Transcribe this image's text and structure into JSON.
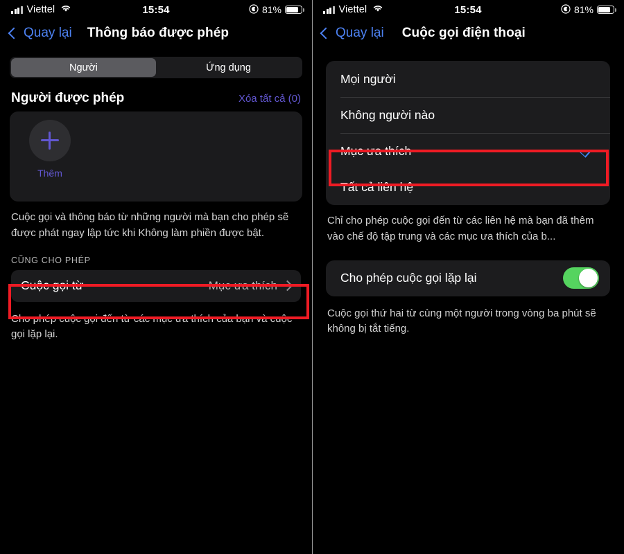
{
  "status_bar": {
    "carrier": "Viettel",
    "time": "15:54",
    "battery_percent": "81%",
    "signal_icon": "cellular-bars-icon",
    "wifi_icon": "wifi-icon",
    "focus_icon": "focus-moon-icon",
    "battery_icon": "battery-icon"
  },
  "left_screen": {
    "nav": {
      "back_label": "Quay lại",
      "title": "Thông báo được phép"
    },
    "segmented": {
      "options": [
        "Người",
        "Ứng dụng"
      ],
      "selected_index": 0
    },
    "section": {
      "title": "Người được phép",
      "action_label": "Xóa tất cả (0)"
    },
    "people_card": {
      "add_label": "Thêm",
      "add_icon": "plus-icon"
    },
    "footnote_1": "Cuộc gọi và thông báo từ những người mà bạn cho phép sẽ được phát ngay lập tức khi Không làm phiền được bật.",
    "group_header": "CŨNG CHO PHÉP",
    "calls_row": {
      "label": "Cuộc gọi từ",
      "value": "Mục ưa thích",
      "chevron_icon": "chevron-right-icon"
    },
    "footnote_2": "Cho phép cuộc gọi đến từ các mục ưa thích của bạn và cuộc gọi lặp lại."
  },
  "right_screen": {
    "nav": {
      "back_label": "Quay lại",
      "title": "Cuộc gọi điện thoại"
    },
    "menu": {
      "items": [
        {
          "label": "Mọi người",
          "checked": false
        },
        {
          "label": "Không người nào",
          "checked": false
        },
        {
          "label": "Mục ưa thích",
          "checked": true
        },
        {
          "label": "Tất cả liên hệ",
          "checked": false
        }
      ],
      "check_icon": "checkmark-icon"
    },
    "footnote_1": "Chỉ cho phép cuộc gọi đến từ các liên hệ mà bạn đã thêm vào chế độ tập trung và các mục ưa thích của b...",
    "repeat_row": {
      "label": "Cho phép cuộc gọi lặp lại",
      "toggle_on": true
    },
    "footnote_2": "Cuộc gọi thứ hai từ cùng một người trong vòng ba phút sẽ không bị tắt tiếng."
  },
  "annotation": {
    "highlight_color": "#ee1b24",
    "accent_blue": "#4d82f3",
    "accent_purple": "#6257d2",
    "toggle_green": "#55d45f",
    "check_blue": "#3f86f5"
  }
}
